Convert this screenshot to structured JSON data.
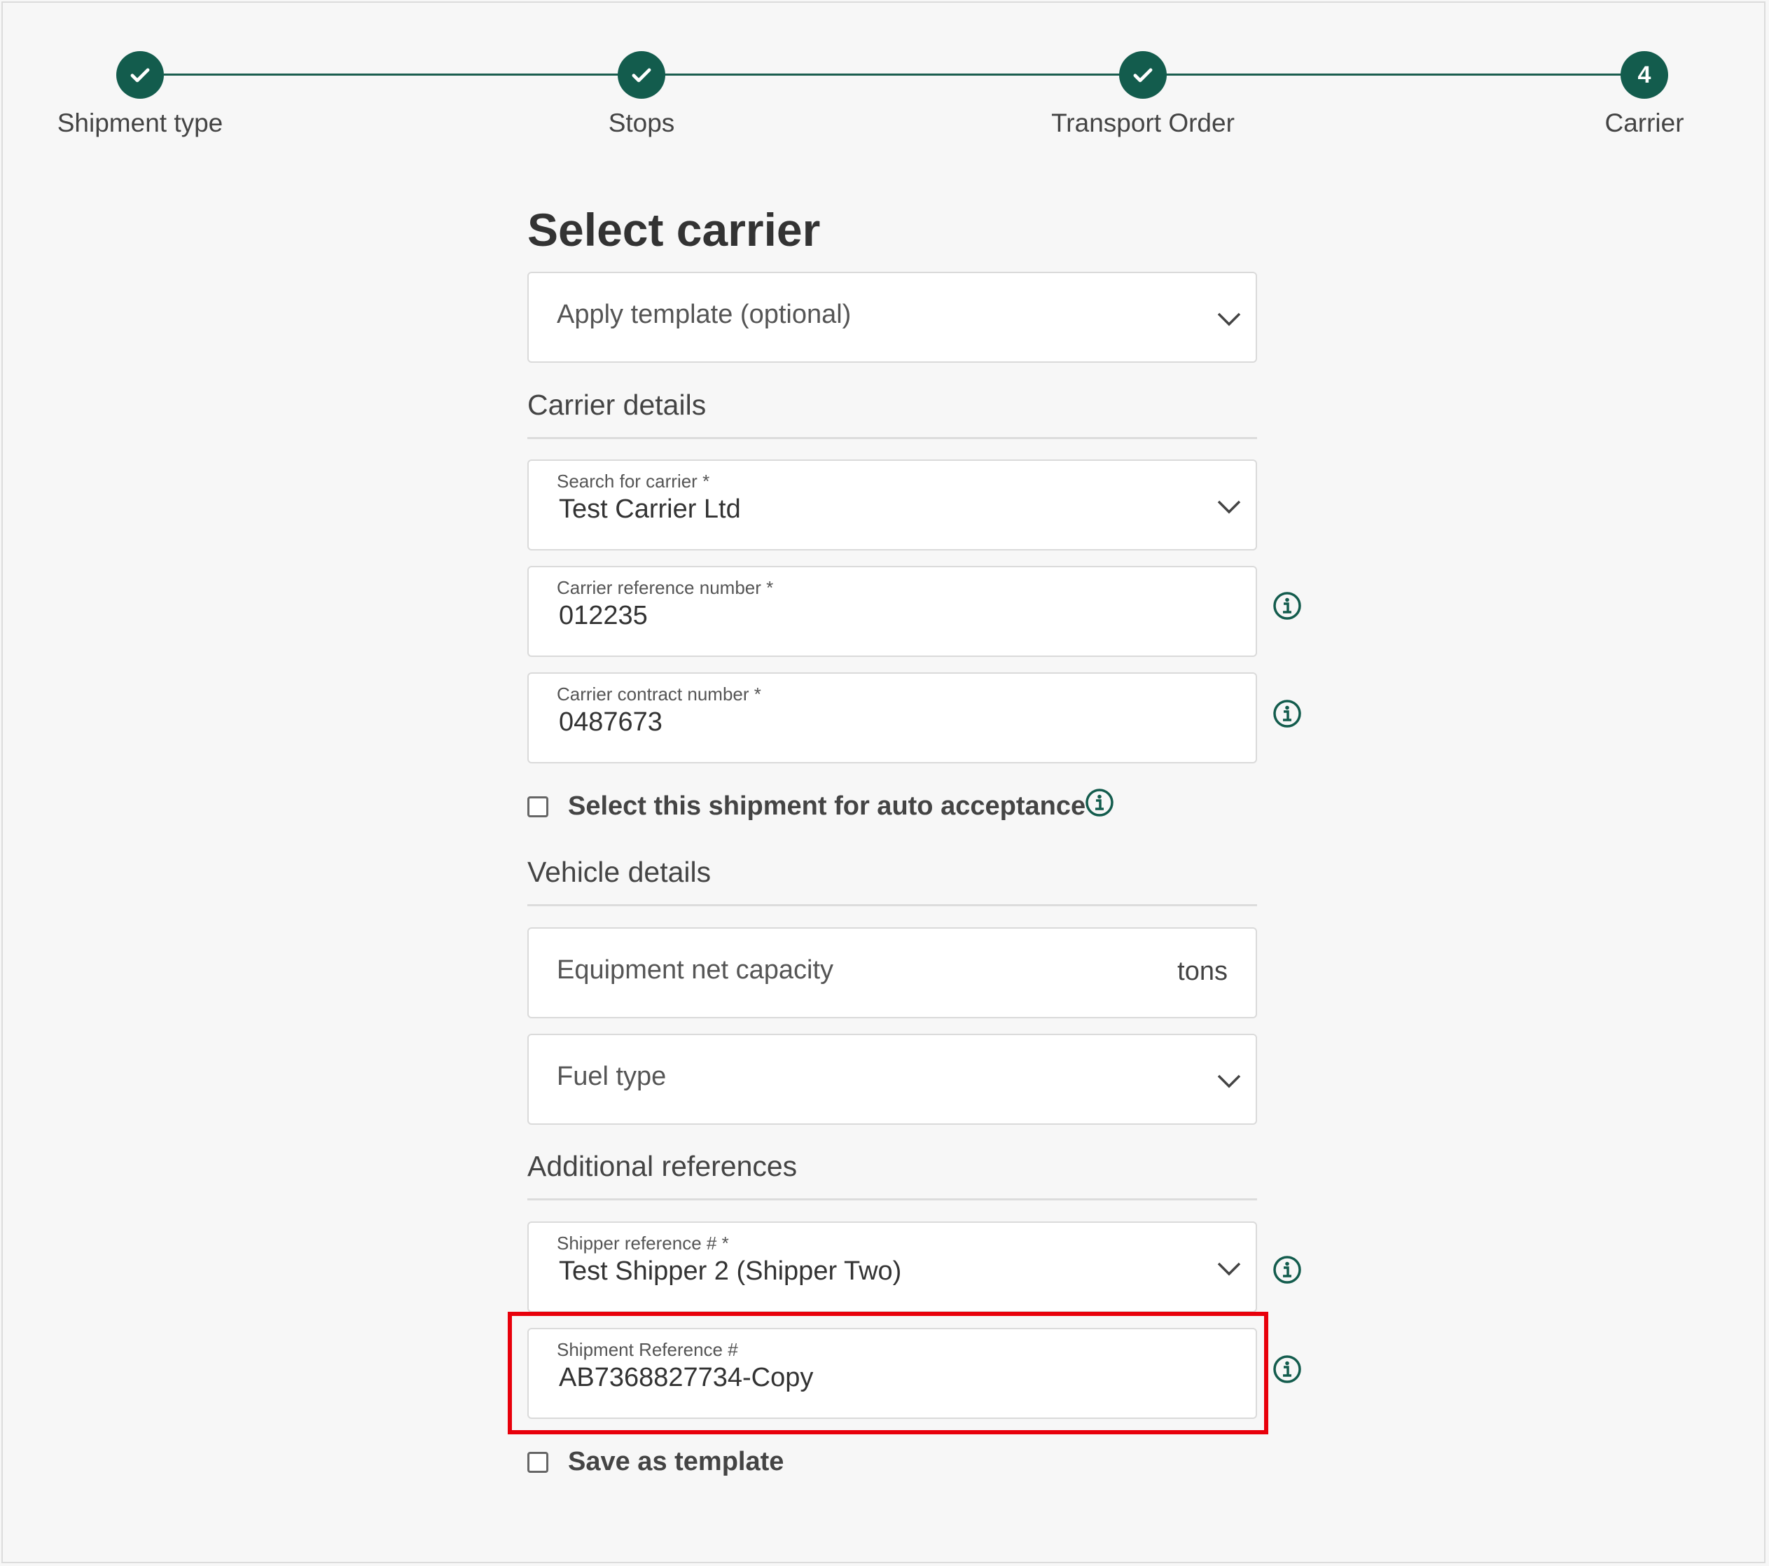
{
  "stepper": {
    "steps": [
      {
        "label": "Shipment type",
        "state": "complete"
      },
      {
        "label": "Stops",
        "state": "complete"
      },
      {
        "label": "Transport Order",
        "state": "complete"
      },
      {
        "label": "Carrier",
        "state": "current",
        "number": "4"
      }
    ]
  },
  "form": {
    "title": "Select carrier",
    "template": {
      "placeholder": "Apply template (optional)"
    },
    "carrier_section": "Carrier details",
    "search_carrier": {
      "label": "Search for carrier *",
      "value": "Test Carrier Ltd"
    },
    "carrier_reference": {
      "label": "Carrier reference number *",
      "value": "012235"
    },
    "carrier_contract": {
      "label": "Carrier contract number *",
      "value": "0487673"
    },
    "auto_acceptance": {
      "label": "Select this shipment for auto acceptance",
      "checked": false
    },
    "vehicle_section": "Vehicle details",
    "capacity": {
      "placeholder": "Equipment net capacity",
      "suffix": "tons"
    },
    "fuel": {
      "placeholder": "Fuel type"
    },
    "references_section": "Additional references",
    "shipper_reference": {
      "label": "Shipper reference # *",
      "value": "Test Shipper 2 (Shipper Two)"
    },
    "shipment_reference": {
      "label": "Shipment Reference #",
      "value": "AB7368827734-Copy"
    },
    "save_template": {
      "label": "Save as template",
      "checked": false
    }
  },
  "colors": {
    "accent": "#135c4d",
    "highlight": "#e8000b"
  }
}
